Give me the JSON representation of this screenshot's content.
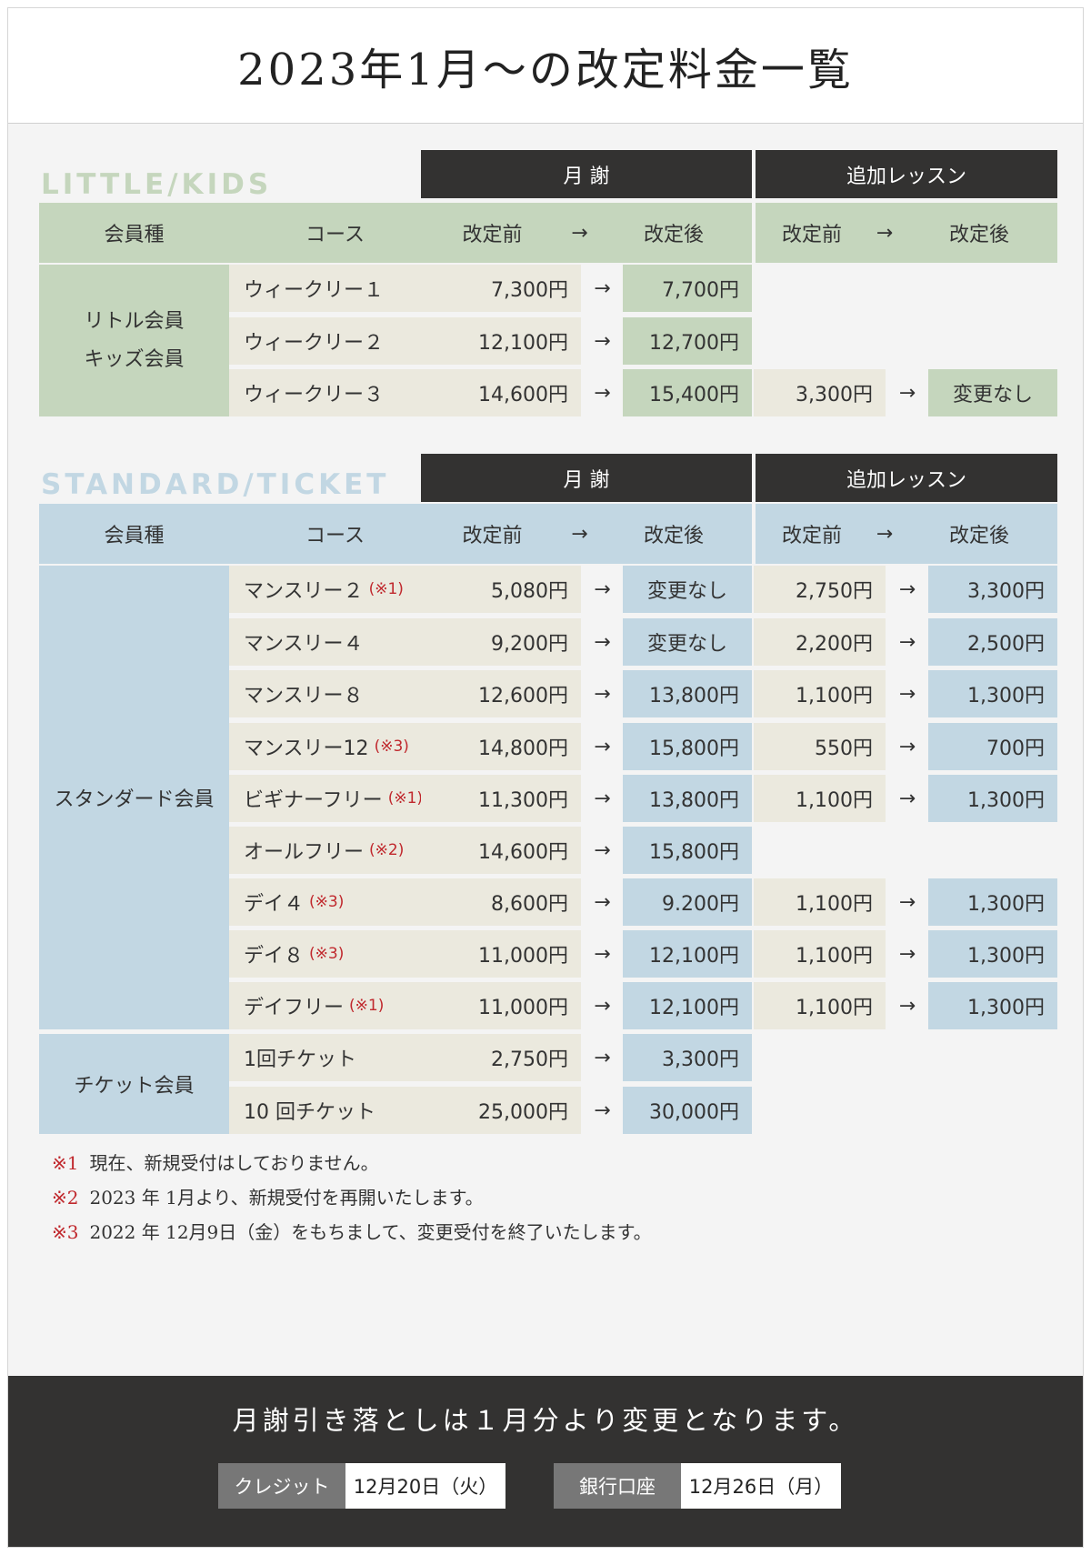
{
  "title": "2023年1月～の改定料金一覧",
  "headers": {
    "monthly": "月 謝",
    "extra": "追加レッスン",
    "member_type": "会員種",
    "course": "コース",
    "before": "改定前",
    "after": "改定後",
    "arrow": "→"
  },
  "section1": {
    "label": "LITTLE/KIDS",
    "member_lines": [
      "リトル会員",
      "キッズ会員"
    ],
    "rows": [
      {
        "course": "ウィークリー１",
        "note": "",
        "m_before": "7,300円",
        "m_after": "7,700円",
        "e_before": "",
        "e_after": ""
      },
      {
        "course": "ウィークリー２",
        "note": "",
        "m_before": "12,100円",
        "m_after": "12,700円",
        "e_before": "",
        "e_after": ""
      },
      {
        "course": "ウィークリー３",
        "note": "",
        "m_before": "14,600円",
        "m_after": "15,400円",
        "e_before": "3,300円",
        "e_after": "変更なし"
      }
    ]
  },
  "section2": {
    "label": "STANDARD/TICKET",
    "standard_member": "スタンダード会員",
    "ticket_member": "チケット会員",
    "rows": [
      {
        "course": "マンスリー２",
        "note": "(※1)",
        "m_before": "5,080円",
        "m_after": "変更なし",
        "e_before": "2,750円",
        "e_after": "3,300円"
      },
      {
        "course": "マンスリー４",
        "note": "",
        "m_before": "9,200円",
        "m_after": "変更なし",
        "e_before": "2,200円",
        "e_after": "2,500円"
      },
      {
        "course": "マンスリー８",
        "note": "",
        "m_before": "12,600円",
        "m_after": "13,800円",
        "e_before": "1,100円",
        "e_after": "1,300円"
      },
      {
        "course": "マンスリー12",
        "note": "(※3)",
        "m_before": "14,800円",
        "m_after": "15,800円",
        "e_before": "550円",
        "e_after": "700円"
      },
      {
        "course": "ビギナーフリー",
        "note": "(※1)",
        "m_before": "11,300円",
        "m_after": "13,800円",
        "e_before": "1,100円",
        "e_after": "1,300円"
      },
      {
        "course": "オールフリー",
        "note": "(※2)",
        "m_before": "14,600円",
        "m_after": "15,800円",
        "e_before": "",
        "e_after": ""
      },
      {
        "course": "デイ４",
        "note": "(※3)",
        "m_before": "8,600円",
        "m_after": "9.200円",
        "e_before": "1,100円",
        "e_after": "1,300円"
      },
      {
        "course": "デイ８",
        "note": "(※3)",
        "m_before": "11,000円",
        "m_after": "12,100円",
        "e_before": "1,100円",
        "e_after": "1,300円"
      },
      {
        "course": "デイフリー",
        "note": "(※1)",
        "m_before": "11,000円",
        "m_after": "12,100円",
        "e_before": "1,100円",
        "e_after": "1,300円"
      },
      {
        "course": "1回チケット",
        "note": "",
        "m_before": "2,750円",
        "m_after": "3,300円",
        "e_before": "",
        "e_after": ""
      },
      {
        "course": "10 回チケット",
        "note": "",
        "m_before": "25,000円",
        "m_after": "30,000円",
        "e_before": "",
        "e_after": ""
      }
    ]
  },
  "notes": [
    {
      "mark": "※1",
      "text": "現在、新規受付はしておりません。"
    },
    {
      "mark": "※2",
      "text": "2023 年 1月より、新規受付を再開いたします。"
    },
    {
      "mark": "※3",
      "text": "2022 年 12月9日（金）をもちまして、変更受付を終了いたします。"
    }
  ],
  "footer": {
    "text": "月謝引き落としは１月分より変更となります。",
    "credit_label": "クレジット",
    "credit_date": "12月20日（火）",
    "bank_label": "銀行口座",
    "bank_date": "12月26日（月）"
  },
  "colors": {
    "little": "#c5d6bd",
    "standard": "#c2d7e3",
    "cream": "#ebe9de",
    "dark": "#333231",
    "note_red": "#c0282d"
  }
}
